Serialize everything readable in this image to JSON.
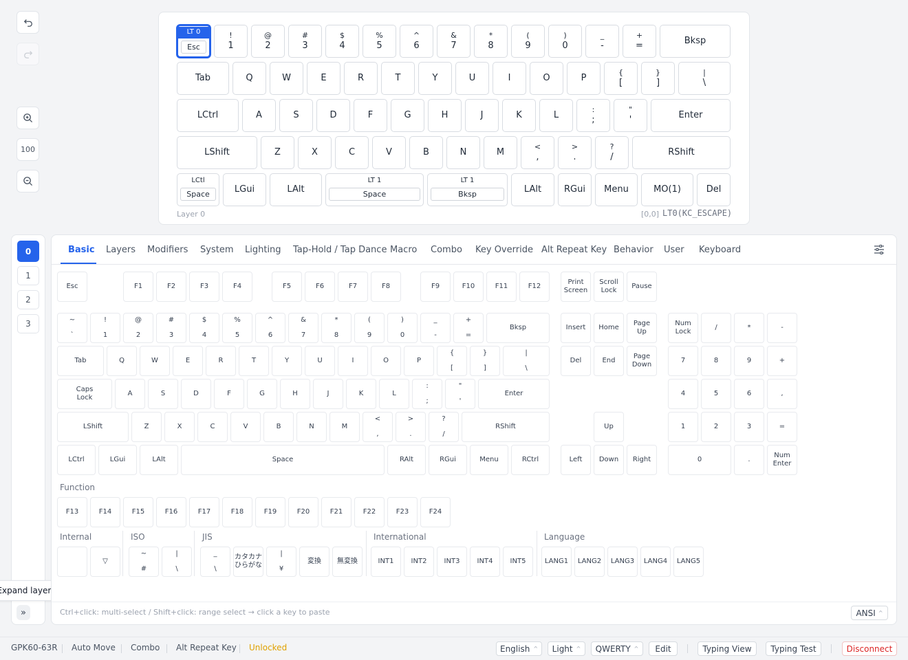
{
  "sidebar": {
    "undo_icon": "undo-icon",
    "redo_icon": "redo-icon",
    "zoom": "100"
  },
  "keyboard": {
    "layer_label": "Layer 0",
    "position": "[0,0]",
    "keycode": "LT0(KC_ESCAPE)",
    "esc": {
      "top": "LT 0",
      "bottom": "Esc"
    },
    "row0": [
      [
        "!",
        "1"
      ],
      [
        "@",
        "2"
      ],
      [
        "#",
        "3"
      ],
      [
        "$",
        "4"
      ],
      [
        "%",
        "5"
      ],
      [
        "^",
        "6"
      ],
      [
        "&",
        "7"
      ],
      [
        "*",
        "8"
      ],
      [
        "(",
        "9"
      ],
      [
        ")",
        "0"
      ],
      [
        "_",
        "-"
      ],
      [
        "+",
        "="
      ]
    ],
    "bksp": "Bksp",
    "row1": [
      "Tab",
      "Q",
      "W",
      "E",
      "R",
      "T",
      "Y",
      "U",
      "I",
      "O",
      "P"
    ],
    "row1_sym": [
      [
        "{",
        "["
      ],
      [
        "}",
        "]"
      ],
      [
        "|",
        "\\"
      ]
    ],
    "row2": [
      "LCtrl",
      "A",
      "S",
      "D",
      "F",
      "G",
      "H",
      "J",
      "K",
      "L"
    ],
    "row2_sym": [
      [
        ":",
        ";"
      ],
      [
        "\"",
        "'"
      ]
    ],
    "enter": "Enter",
    "row3": [
      "LShift",
      "Z",
      "X",
      "C",
      "V",
      "B",
      "N",
      "M"
    ],
    "row3_sym": [
      [
        "<",
        ","
      ],
      [
        ">",
        "."
      ],
      [
        "?",
        "/"
      ]
    ],
    "rshift": "RShift",
    "space_lt": {
      "top": "LCtl",
      "bottom": "Space"
    },
    "lgui": "LGui",
    "lalt": "LAlt",
    "lt1_space": {
      "top": "LT 1",
      "bottom": "Space"
    },
    "lt1_bksp": {
      "top": "LT 1",
      "bottom": "Bksp"
    },
    "lalt2": "LAlt",
    "rgui": "RGui",
    "menu": "Menu",
    "mo1": "MO(1)",
    "del": "Del"
  },
  "layers": [
    "0",
    "1",
    "2",
    "3"
  ],
  "expand_tooltip": "Expand layers",
  "expand_icon": "»",
  "tabs": [
    "Basic",
    "Layers",
    "Modifiers",
    "System",
    "Lighting",
    "Tap-Hold / Tap Dance",
    "Macro",
    "Combo",
    "Key Override",
    "Alt Repeat Key",
    "Behavior",
    "User",
    "Keyboard"
  ],
  "palette": {
    "esc": "Esc",
    "f1_12": [
      "F1",
      "F2",
      "F3",
      "F4",
      "F5",
      "F6",
      "F7",
      "F8",
      "F9",
      "F10",
      "F11",
      "F12"
    ],
    "sys": [
      [
        "Print",
        "Screen"
      ],
      [
        "Scroll",
        "Lock"
      ],
      [
        "Pause",
        ""
      ]
    ],
    "num_row": [
      [
        "~",
        "`"
      ],
      [
        "!",
        "1"
      ],
      [
        "@",
        "2"
      ],
      [
        "#",
        "3"
      ],
      [
        "$",
        "4"
      ],
      [
        "%",
        "5"
      ],
      [
        "^",
        "6"
      ],
      [
        "&",
        "7"
      ],
      [
        "*",
        "8"
      ],
      [
        "(",
        "9"
      ],
      [
        ")",
        "0"
      ],
      [
        "_",
        "-"
      ],
      [
        "+",
        "="
      ]
    ],
    "bksp": "Bksp",
    "tab": "Tab",
    "qrow": [
      "Q",
      "W",
      "E",
      "R",
      "T",
      "Y",
      "U",
      "I",
      "O",
      "P"
    ],
    "qrow_sym": [
      [
        "{",
        "["
      ],
      [
        "}",
        "]"
      ],
      [
        "|",
        "\\"
      ]
    ],
    "caps": [
      "Caps",
      "Lock"
    ],
    "arow": [
      "A",
      "S",
      "D",
      "F",
      "G",
      "H",
      "J",
      "K",
      "L"
    ],
    "arow_sym": [
      [
        ":",
        ";"
      ],
      [
        "\"",
        "'"
      ]
    ],
    "enter": "Enter",
    "lshift": "LShift",
    "zrow": [
      "Z",
      "X",
      "C",
      "V",
      "B",
      "N",
      "M"
    ],
    "zrow_sym": [
      [
        "<",
        ","
      ],
      [
        ">",
        "."
      ],
      [
        "?",
        "/"
      ]
    ],
    "rshift": "RShift",
    "bottom": [
      "LCtrl",
      "LGui",
      "LAlt",
      "Space",
      "RAlt",
      "RGui",
      "Menu",
      "RCtrl"
    ],
    "nav1": [
      "Insert",
      "Home",
      [
        "Page",
        "Up"
      ]
    ],
    "nav2": [
      "Del",
      "End",
      [
        "Page",
        "Down"
      ]
    ],
    "arrows": [
      "Up",
      "Left",
      "Down",
      "Right"
    ],
    "numpad": [
      [
        [
          "Num",
          "Lock"
        ],
        "/",
        "*",
        "-"
      ],
      [
        "7",
        "8",
        "9",
        "+"
      ],
      [
        "4",
        "5",
        "6",
        ","
      ],
      [
        "1",
        "2",
        "3",
        "="
      ]
    ],
    "numpad_bottom": [
      "0",
      ".",
      [
        "Num",
        "Enter"
      ]
    ],
    "function_label": "Function",
    "f13_24": [
      "F13",
      "F14",
      "F15",
      "F16",
      "F17",
      "F18",
      "F19",
      "F20",
      "F21",
      "F22",
      "F23",
      "F24"
    ],
    "internal_label": "Internal",
    "internal_icon": "▽",
    "iso_label": "ISO",
    "iso": [
      [
        "~",
        "#"
      ],
      [
        "|",
        "\\"
      ]
    ],
    "jis_label": "JIS",
    "jis": [
      [
        "_",
        "\\"
      ],
      [
        "カタカナ",
        "ひらがな"
      ],
      [
        "|",
        "¥"
      ],
      "変換",
      "無変換"
    ],
    "intl_label": "International",
    "intl": [
      "INT1",
      "INT2",
      "INT3",
      "INT4",
      "INT5"
    ],
    "lang_label": "Language",
    "lang": [
      "LANG1",
      "LANG2",
      "LANG3",
      "LANG4",
      "LANG5"
    ],
    "hint": "Ctrl+click: multi-select / Shift+click: range select → click a key to paste",
    "layout": "ANSI"
  },
  "status": {
    "device": "GPK60-63R",
    "auto_move": "Auto Move",
    "combo": "Combo",
    "alt_repeat": "Alt Repeat Key",
    "unlocked": "Unlocked",
    "language": "English",
    "theme": "Light",
    "keymap": "QWERTY",
    "edit": "Edit",
    "typing_view": "Typing View",
    "typing_test": "Typing Test",
    "disconnect": "Disconnect"
  },
  "colors": {
    "accent": "#2563eb",
    "unlocked": "#e0a100",
    "disconnect": "#dc2626"
  }
}
